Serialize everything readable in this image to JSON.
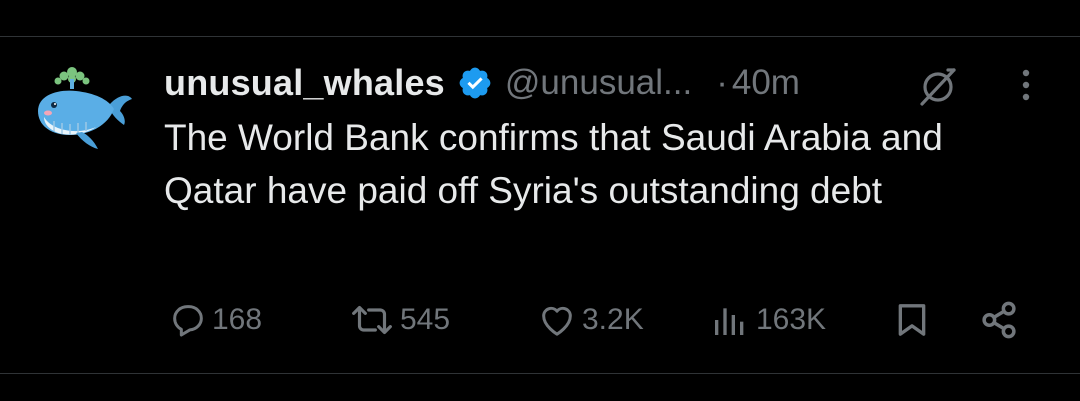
{
  "post": {
    "author_name": "unusual_whales",
    "author_handle": "@unusual...",
    "time_separator": "·",
    "time": "40m",
    "text": "The World Bank confirms that Saudi Arabia and Qatar have paid off Syria's outstanding debt"
  },
  "metrics": {
    "replies": "168",
    "reposts": "545",
    "likes": "3.2K",
    "views": "163K"
  },
  "icons": {
    "verified": "verified-badge-icon",
    "grok": "grok-icon",
    "more": "more-options-icon",
    "reply": "reply-icon",
    "repost": "repost-icon",
    "like": "heart-icon",
    "views": "views-icon",
    "bookmark": "bookmark-icon",
    "share": "share-icon"
  },
  "colors": {
    "background": "#000000",
    "primary_text": "#e7e9ea",
    "secondary_text": "#71767b",
    "verified_blue": "#1d9bf0",
    "divider": "#2f3336"
  }
}
